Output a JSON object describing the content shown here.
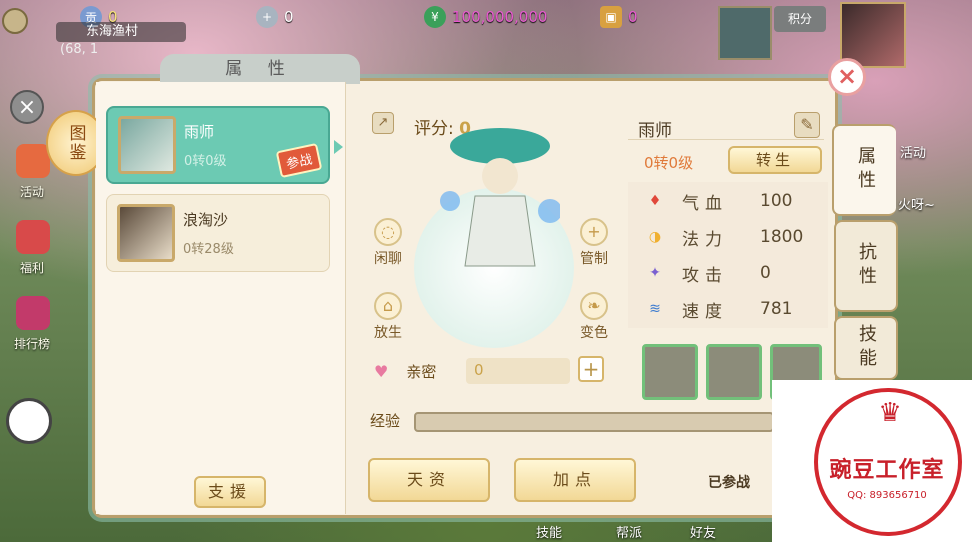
{
  "topbar": {
    "coupon_value": "0",
    "silver_value": "0",
    "gold_value": "100,000,000",
    "ticket_value": "0",
    "location_name": "东海渔村",
    "location_coords": "(68, 1",
    "points_label": "积分",
    "activity_label": "活动",
    "chat_snippet": "火呀~"
  },
  "sidebar_left": {
    "items": [
      "活动",
      "福利",
      "排行榜"
    ],
    "codex_label": "图鉴"
  },
  "panel": {
    "title": "属 性",
    "pets": [
      {
        "name": "雨师",
        "level": "0转0级",
        "tag": "参战"
      },
      {
        "name": "浪淘沙",
        "level": "0转28级"
      }
    ],
    "support_button": "支援",
    "score_label": "评分:",
    "score_value": "0",
    "actions": {
      "chat": "闲聊",
      "control": "管制",
      "release": "放生",
      "color": "变色"
    },
    "intimacy_label": "亲密",
    "intimacy_value": "0",
    "exp_label": "经验",
    "aptitude_button": "天资",
    "addpoint_button": "加点",
    "battle_status": "已参战"
  },
  "stats": {
    "pet_name": "雨师",
    "rebirth_level": "0转0级",
    "rebirth_button": "转生",
    "rows": [
      {
        "label": "气血",
        "value": "100",
        "color": "#e0483a"
      },
      {
        "label": "法力",
        "value": "1800",
        "color": "#f0b030"
      },
      {
        "label": "攻击",
        "value": "0",
        "color": "#7a60d0"
      },
      {
        "label": "速度",
        "value": "781",
        "color": "#3a7ad0"
      }
    ]
  },
  "right_tabs": [
    "属性",
    "抗性",
    "技能"
  ],
  "bottom_bar": [
    "技能",
    "帮派",
    "好友"
  ],
  "watermark": {
    "name": "豌豆工作室",
    "qq": "QQ: 893656710"
  }
}
